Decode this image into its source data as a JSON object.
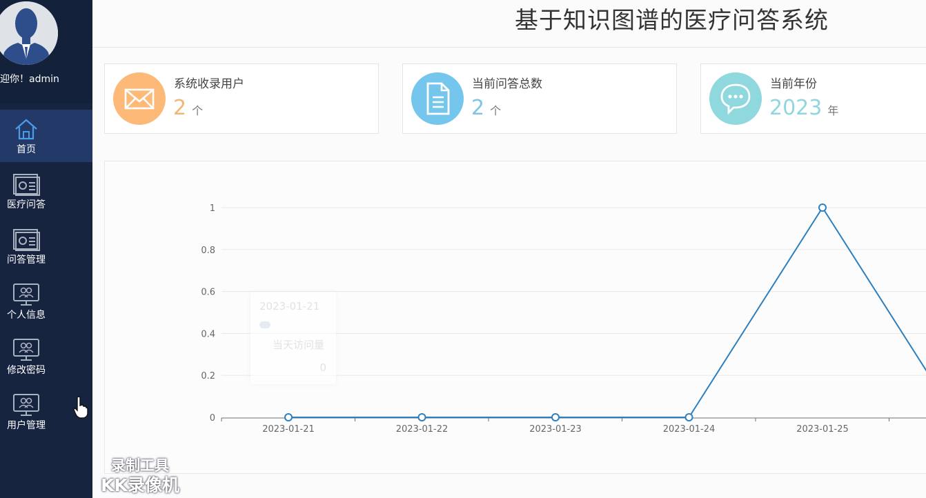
{
  "app": {
    "title": "基于知识图谱的医疗问答系统"
  },
  "user": {
    "welcome": "迎你！admin"
  },
  "sidebar": {
    "items": [
      {
        "label": "首页",
        "icon": "home-icon"
      },
      {
        "label": "医疗问答",
        "icon": "document-chart-icon"
      },
      {
        "label": "问答管理",
        "icon": "document-chart-icon"
      },
      {
        "label": "个人信息",
        "icon": "monitor-users-icon"
      },
      {
        "label": "修改密码",
        "icon": "monitor-users-icon"
      },
      {
        "label": "用户管理",
        "icon": "monitor-users-icon"
      }
    ]
  },
  "stats": [
    {
      "label": "系统收录用户",
      "value": "2",
      "unit": "个",
      "icon": "envelope-icon",
      "color": "#fdb978",
      "num_color": "#f3b574"
    },
    {
      "label": "当前问答总数",
      "value": "2",
      "unit": "个",
      "icon": "document-icon",
      "color": "#74c6ec",
      "num_color": "#7fc3e6"
    },
    {
      "label": "当前年份",
      "value": "2023",
      "unit": "年",
      "icon": "chat-bubble-icon",
      "color": "#8fd8de",
      "num_color": "#90d6de"
    }
  ],
  "chart_data": {
    "type": "line",
    "categories": [
      "2023-01-21",
      "2023-01-22",
      "2023-01-23",
      "2023-01-24",
      "2023-01-25"
    ],
    "series": [
      {
        "name": "当天访问量",
        "values": [
          0,
          0,
          0,
          0,
          1
        ]
      }
    ],
    "ylim": [
      0,
      1
    ],
    "yticks": [
      "0",
      "0.2",
      "0.4",
      "0.6",
      "0.8",
      "1"
    ],
    "grid": true,
    "line_color": "#2c7fbf"
  },
  "tooltip": {
    "date": "2023-01-21",
    "series_name": "当天访问量",
    "value": "0"
  },
  "watermark": {
    "line1": "录制工具",
    "line2": "KK录像机"
  }
}
